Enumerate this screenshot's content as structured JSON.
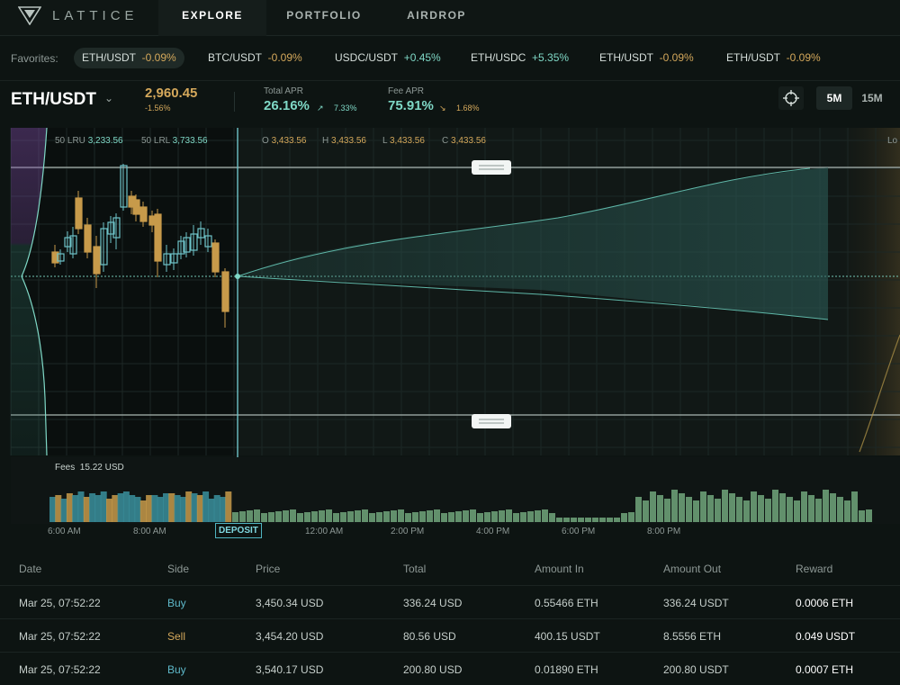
{
  "nav": {
    "brand": "LATTICE",
    "tabs": [
      {
        "label": "EXPLORE"
      },
      {
        "label": "PORTFOLIO"
      },
      {
        "label": "AIRDROP"
      }
    ]
  },
  "favorites": {
    "label": "Favorites:",
    "items": [
      {
        "pair": "ETH/USDT",
        "change": "-0.09%",
        "dir": "neg"
      },
      {
        "pair": "BTC/USDT",
        "change": "-0.09%",
        "dir": "neg"
      },
      {
        "pair": "USDC/USDT",
        "change": "+0.45%",
        "dir": "pos"
      },
      {
        "pair": "ETH/USDC",
        "change": "+5.35%",
        "dir": "pos"
      },
      {
        "pair": "ETH/USDT",
        "change": "-0.09%",
        "dir": "neg"
      },
      {
        "pair": "ETH/USDT",
        "change": "-0.09%",
        "dir": "neg"
      }
    ]
  },
  "header": {
    "pair": "ETH/USDT",
    "price": "2,960.45",
    "price_change": "-1.56%",
    "total_apr_label": "Total APR",
    "total_apr": "26.16%",
    "total_apr_change": "7.33%",
    "fee_apr_label": "Fee APR",
    "fee_apr": "75.91%",
    "fee_apr_change": "1.68%",
    "timeframes": [
      "5M",
      "15M"
    ]
  },
  "indicators": {
    "lru_label": "50 LRU",
    "lru_value": "3,233.56",
    "lrl_label": "50 LRL",
    "lrl_value": "3,733.56",
    "o_label": "O",
    "o_value": "3,433.56",
    "h_label": "H",
    "h_value": "3,433.56",
    "l_label": "L",
    "l_value": "3,433.56",
    "c_label": "C",
    "c_value": "3,433.56",
    "right_label": "Lo"
  },
  "fees": {
    "label": "Fees",
    "value": "15.22 USD"
  },
  "deposit_label": "DEPOSIT",
  "time_ticks": [
    "6:00 AM",
    "8:00 AM",
    "12:00 AM",
    "2:00 PM",
    "4:00 PM",
    "6:00 PM",
    "8:00 PM"
  ],
  "colors": {
    "accent": "#7fd8c6",
    "negative": "#d4a85b",
    "buy": "#5eb8c9",
    "fee_green": "#7fb98a"
  },
  "table": {
    "columns": [
      "Date",
      "Side",
      "Price",
      "Total",
      "Amount In",
      "Amount Out",
      "Reward"
    ],
    "rows": [
      [
        "Mar 25, 07:52:22",
        "Buy",
        "3,450.34 USD",
        "336.24 USD",
        "0.55466 ETH",
        "336.24 USDT",
        "0.0006 ETH"
      ],
      [
        "Mar 25, 07:52:22",
        "Sell",
        "3,454.20 USD",
        "80.56 USD",
        "400.15 USDT",
        "8.5556 ETH",
        "0.049 USDT"
      ],
      [
        "Mar 25, 07:52:22",
        "Buy",
        "3,540.17 USD",
        "200.80 USD",
        "0.01890 ETH",
        "200.80 USDT",
        "0.0007 ETH"
      ]
    ]
  }
}
